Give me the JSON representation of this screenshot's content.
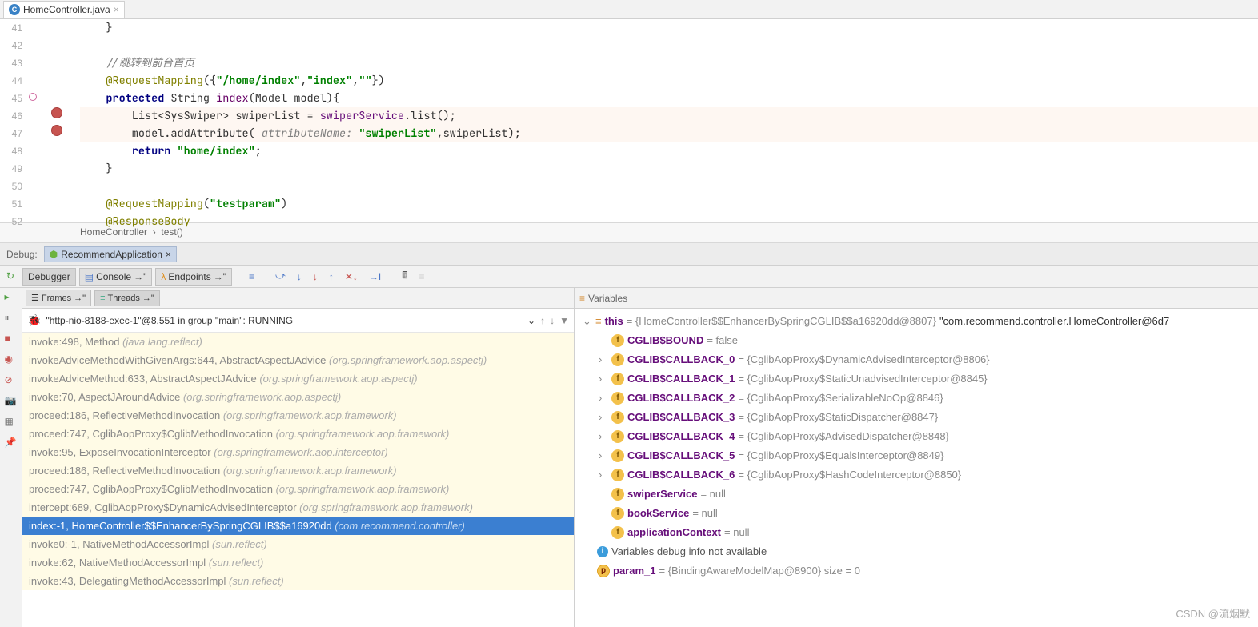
{
  "tab": {
    "filename": "HomeController.java"
  },
  "lines": {
    "41": "41",
    "42": "42",
    "43": "43",
    "44": "44",
    "45": "45",
    "46": "46",
    "47": "47",
    "48": "48",
    "49": "49",
    "50": "50",
    "51": "51",
    "52": "52"
  },
  "code": {
    "l43_cmt": "//跳转到前台首页",
    "l44_ann": "@RequestMapping",
    "l44_args": "({\"/home/index\",\"index\",\"\"})",
    "l45": "protected String index(Model model){",
    "l46": "List<SysSwiper> swiperList = swiperService.list();",
    "l47_a": "model.addAttribute(",
    "l47_param": "attributeName:",
    "l47_str": "\"swiperList\"",
    "l47_b": ",swiperList);",
    "l48_a": "return ",
    "l48_str": "\"home/index\"",
    "l48_b": ";",
    "l51_ann": "@RequestMapping",
    "l51_args": "(\"testparam\")",
    "l52_ann": "@ResponseBody"
  },
  "breadcrumb": {
    "class": "HomeController",
    "method": "test()"
  },
  "debug": {
    "label": "Debug:",
    "run_config": "RecommendApplication",
    "tabs": {
      "debugger": "Debugger",
      "console": "Console",
      "endpoints": "Endpoints"
    }
  },
  "frames": {
    "tabs": {
      "frames": "Frames",
      "threads": "Threads"
    },
    "thread": "\"http-nio-8188-exec-1\"@8,551 in group \"main\": RUNNING",
    "stack": [
      {
        "m": "invoke:498, Method",
        "p": "(java.lang.reflect)",
        "lib": true
      },
      {
        "m": "invokeAdviceMethodWithGivenArgs:644, AbstractAspectJAdvice",
        "p": "(org.springframework.aop.aspectj)",
        "lib": true
      },
      {
        "m": "invokeAdviceMethod:633, AbstractAspectJAdvice",
        "p": "(org.springframework.aop.aspectj)",
        "lib": true
      },
      {
        "m": "invoke:70, AspectJAroundAdvice",
        "p": "(org.springframework.aop.aspectj)",
        "lib": true
      },
      {
        "m": "proceed:186, ReflectiveMethodInvocation",
        "p": "(org.springframework.aop.framework)",
        "lib": true
      },
      {
        "m": "proceed:747, CglibAopProxy$CglibMethodInvocation",
        "p": "(org.springframework.aop.framework)",
        "lib": true
      },
      {
        "m": "invoke:95, ExposeInvocationInterceptor",
        "p": "(org.springframework.aop.interceptor)",
        "lib": true
      },
      {
        "m": "proceed:186, ReflectiveMethodInvocation",
        "p": "(org.springframework.aop.framework)",
        "lib": true
      },
      {
        "m": "proceed:747, CglibAopProxy$CglibMethodInvocation",
        "p": "(org.springframework.aop.framework)",
        "lib": true
      },
      {
        "m": "intercept:689, CglibAopProxy$DynamicAdvisedInterceptor",
        "p": "(org.springframework.aop.framework)",
        "lib": true
      },
      {
        "m": "index:-1, HomeController$$EnhancerBySpringCGLIB$$a16920dd",
        "p": "(com.recommend.controller)",
        "sel": true
      },
      {
        "m": "invoke0:-1, NativeMethodAccessorImpl",
        "p": "(sun.reflect)",
        "lib": true
      },
      {
        "m": "invoke:62, NativeMethodAccessorImpl",
        "p": "(sun.reflect)",
        "lib": true
      },
      {
        "m": "invoke:43, DelegatingMethodAccessorImpl",
        "p": "(sun.reflect)",
        "lib": true
      }
    ]
  },
  "variables": {
    "header": "Variables",
    "this_name": "this",
    "this_val": " = {HomeController$$EnhancerBySpringCGLIB$$a16920dd@8807} ",
    "this_str": "\"com.recommend.controller.HomeController@6d7",
    "fields": [
      {
        "name": "CGLIB$BOUND",
        "val": " = false",
        "exp": false
      },
      {
        "name": "CGLIB$CALLBACK_0",
        "val": " = {CglibAopProxy$DynamicAdvisedInterceptor@8806}",
        "exp": true
      },
      {
        "name": "CGLIB$CALLBACK_1",
        "val": " = {CglibAopProxy$StaticUnadvisedInterceptor@8845}",
        "exp": true
      },
      {
        "name": "CGLIB$CALLBACK_2",
        "val": " = {CglibAopProxy$SerializableNoOp@8846}",
        "exp": true
      },
      {
        "name": "CGLIB$CALLBACK_3",
        "val": " = {CglibAopProxy$StaticDispatcher@8847}",
        "exp": true
      },
      {
        "name": "CGLIB$CALLBACK_4",
        "val": " = {CglibAopProxy$AdvisedDispatcher@8848}",
        "exp": true
      },
      {
        "name": "CGLIB$CALLBACK_5",
        "val": " = {CglibAopProxy$EqualsInterceptor@8849}",
        "exp": true
      },
      {
        "name": "CGLIB$CALLBACK_6",
        "val": " = {CglibAopProxy$HashCodeInterceptor@8850}",
        "exp": true
      },
      {
        "name": "swiperService",
        "val": " = null",
        "exp": false
      },
      {
        "name": "bookService",
        "val": " = null",
        "exp": false
      },
      {
        "name": "applicationContext",
        "val": " = null",
        "exp": false
      }
    ],
    "info": "Variables debug info not available",
    "param_name": "param_1",
    "param_val": " = {BindingAwareModelMap@8900}  size = 0"
  },
  "watermark": "CSDN @流烟默"
}
